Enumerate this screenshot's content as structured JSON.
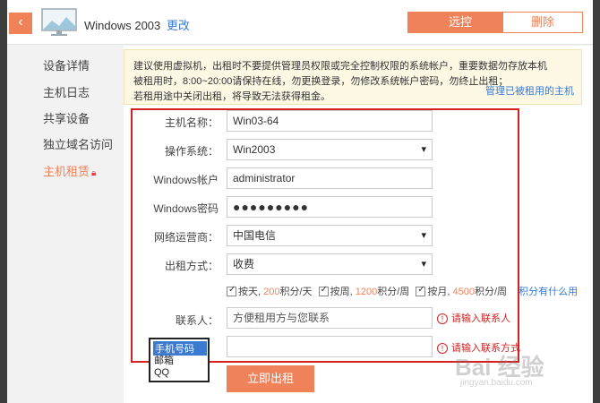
{
  "header": {
    "title": "Windows 2003",
    "edit_label": "更改",
    "remote_label": "远控",
    "delete_label": "删除"
  },
  "sidebar": {
    "items": [
      {
        "label": "设备详情"
      },
      {
        "label": "主机日志"
      },
      {
        "label": "共享设备"
      },
      {
        "label": "独立域名访问"
      },
      {
        "label": "主机租赁"
      }
    ]
  },
  "notice": {
    "line1": "建议使用虚拟机，出租时不要提供管理员权限或完全控制权限的系统帐户，重要数据勿存放本机",
    "line2": "被租用时，8:00~20:00请保持在线，勿更换登录，勿修改系统帐户密码，勿终止出租；",
    "line3": "若租用途中关闭出租，将导致无法获得租金。",
    "rented_link": "管理已被租用的主机"
  },
  "form": {
    "host_name_label": "主机名称：",
    "host_name_value": "Win03-64",
    "os_label": "操作系统：",
    "os_value": "Win2003",
    "account_label": "Windows帐户",
    "account_value": "administrator",
    "password_label": "Windows密码",
    "password_value": "●●●●●●●●●",
    "isp_label": "网络运营商：",
    "isp_value": "中国电信",
    "rent_mode_label": "出租方式：",
    "rent_mode_value": "收费",
    "options": {
      "by_day_prefix": "按天,",
      "by_day_points": "200",
      "by_day_suffix": "积分/天",
      "by_week_prefix": "按周,",
      "by_week_points": "1200",
      "by_week_suffix": "积分/周",
      "by_month_prefix": "按月,",
      "by_month_points": "4500",
      "by_month_suffix": "积分/周",
      "points_link": "积分有什么用"
    },
    "contact_label": "联系人：",
    "contact_placeholder": "方便租用方与您联系",
    "contact_error": "请输入联系人",
    "contact_method_error": "请输入联系方式",
    "submit_label": "立即出租"
  },
  "dropdown": {
    "options": [
      "手机号码",
      "邮箱",
      "QQ"
    ]
  },
  "watermark": {
    "main": "Bai 经验",
    "sub": "jingyan.baidu.com"
  },
  "colors": {
    "accent": "#f0825a",
    "link": "#3a7ad0",
    "error": "#d42020"
  }
}
